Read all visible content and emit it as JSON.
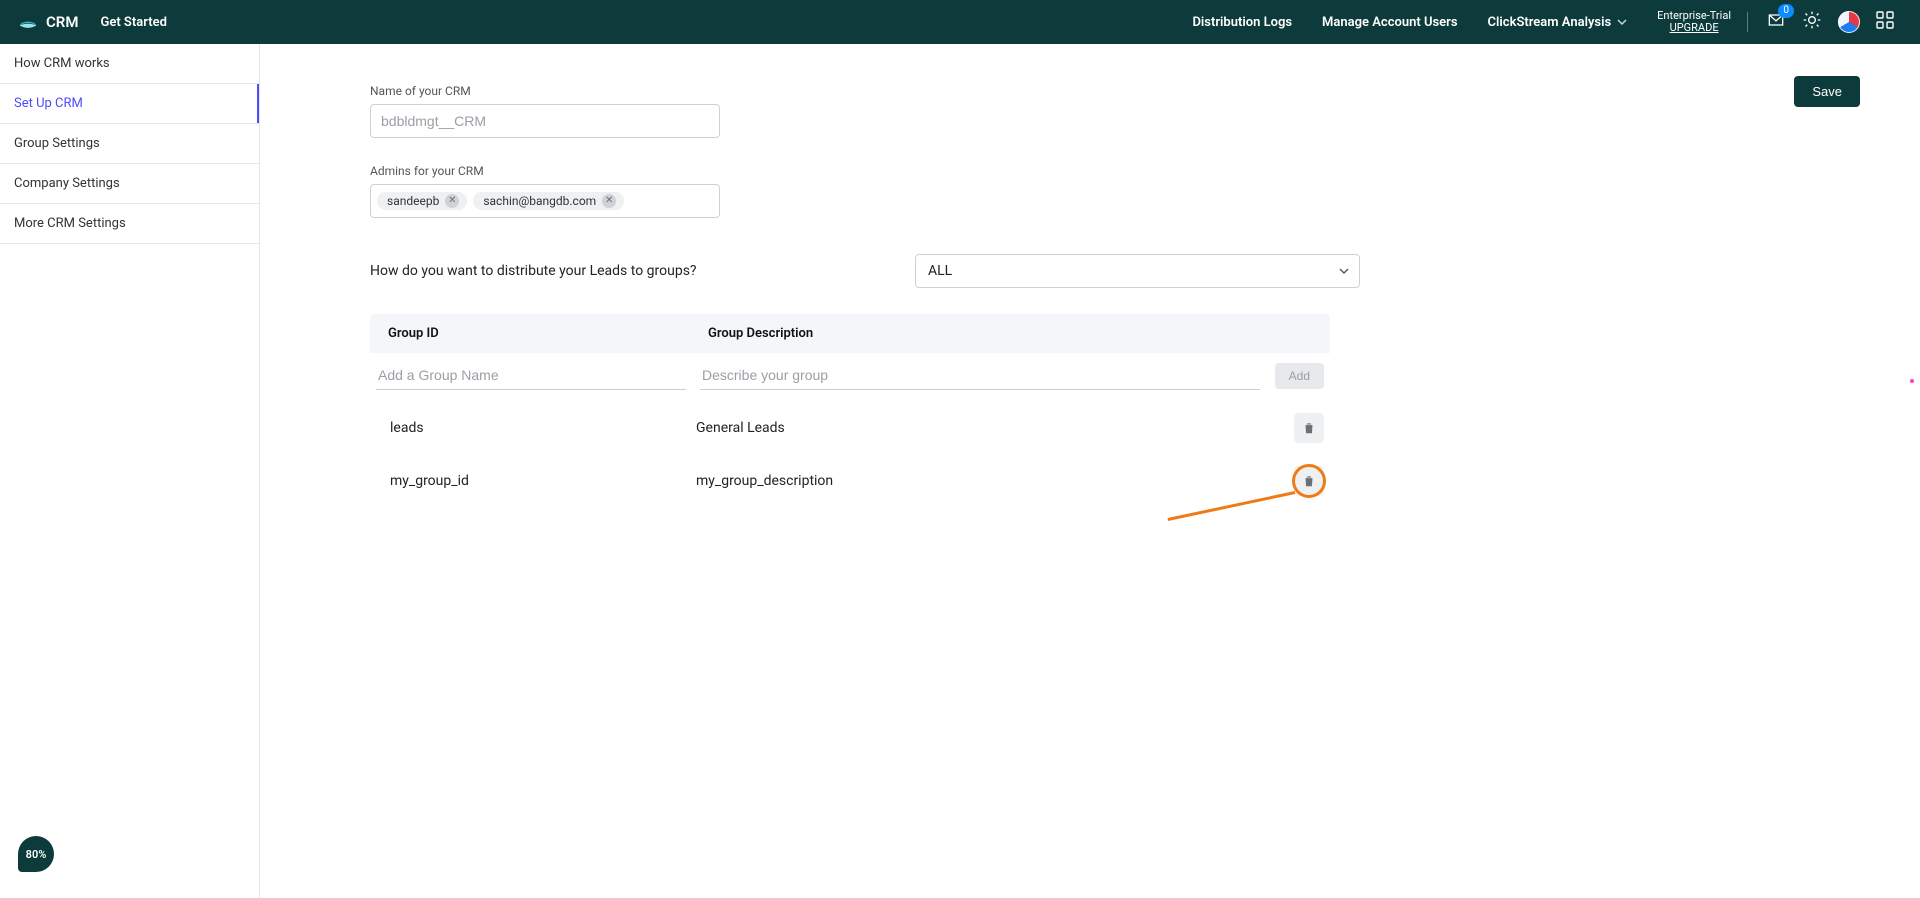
{
  "topbar": {
    "brand": "CRM",
    "get_started": "Get Started",
    "links": {
      "distribution_logs": "Distribution Logs",
      "manage_account_users": "Manage Account Users",
      "clickstream_analysis": "ClickStream Analysis"
    },
    "trial": {
      "line1": "Enterprise-Trial",
      "line2": "UPGRADE"
    },
    "notifications_badge": "0"
  },
  "sidebar": {
    "items": [
      {
        "label": "How CRM works"
      },
      {
        "label": "Set Up CRM"
      },
      {
        "label": "Group Settings"
      },
      {
        "label": "Company Settings"
      },
      {
        "label": "More CRM Settings"
      }
    ],
    "active_index": 1
  },
  "setup": {
    "save_label": "Save",
    "name_label": "Name of your CRM",
    "name_placeholder": "bdbldmgt__CRM",
    "name_value": "",
    "admins_label": "Admins for your CRM",
    "admins": [
      "sandeepb",
      "sachin@bangdb.com"
    ],
    "distribute_question": "How do you want to distribute your Leads to groups?",
    "distribute_selected": "ALL",
    "table": {
      "headers": {
        "id": "Group ID",
        "desc": "Group Description"
      },
      "input_id_placeholder": "Add a Group Name",
      "input_desc_placeholder": "Describe your group",
      "add_label": "Add",
      "rows": [
        {
          "id": "leads",
          "desc": "General Leads"
        },
        {
          "id": "my_group_id",
          "desc": "my_group_description"
        }
      ]
    }
  },
  "progress": "80%"
}
